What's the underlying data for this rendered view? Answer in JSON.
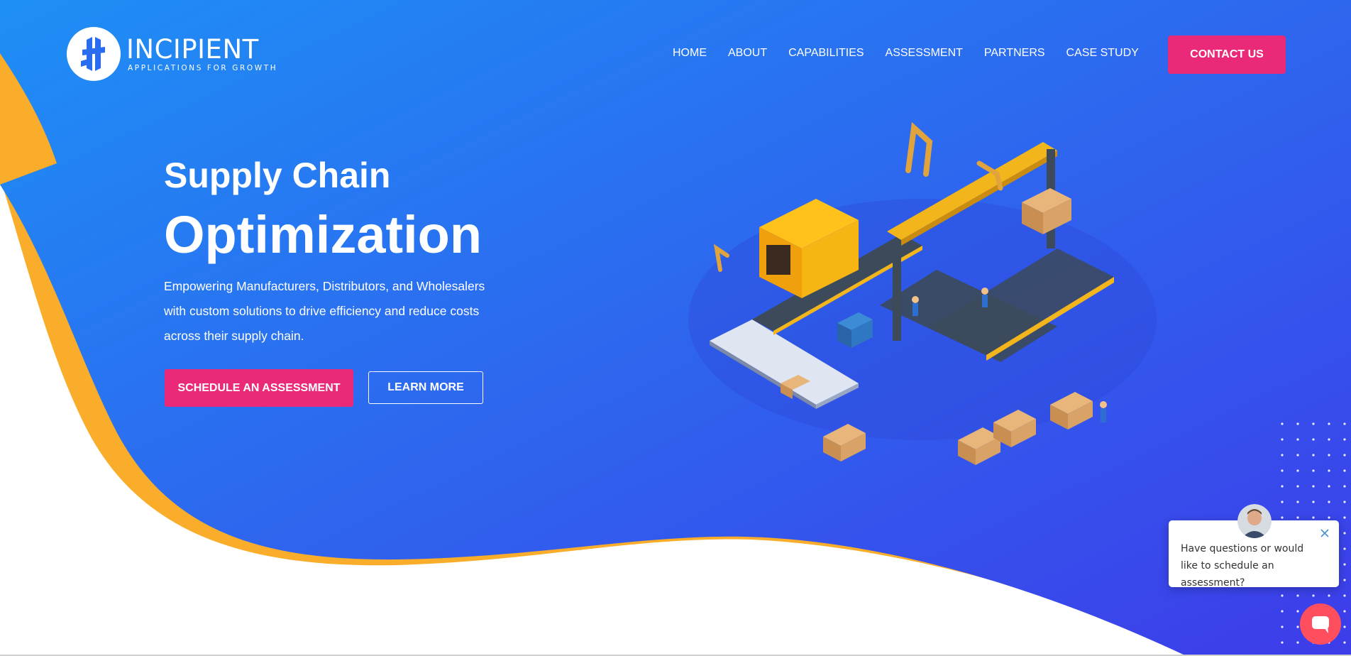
{
  "brand": {
    "name": "INCIPIENT",
    "tagline": "APPLICATIONS FOR GROWTH"
  },
  "nav": {
    "home": "HOME",
    "about": "ABOUT",
    "capabilities": "CAPABILITIES",
    "assessment": "ASSESSMENT",
    "partners": "PARTNERS",
    "case_study": "CASE STUDY"
  },
  "header": {
    "contact_label": "CONTACT US"
  },
  "hero": {
    "subtitle": "Supply Chain",
    "title": "Optimization",
    "description": "Empowering Manufacturers, Distributors, and Wholesalers with custom solutions to drive efficiency and reduce costs across their supply chain.",
    "primary_cta": "SCHEDULE AN ASSESSMENT",
    "secondary_cta": "LEARN MORE"
  },
  "chat": {
    "message": "Have questions or would like to schedule an assessment?"
  },
  "icons": [
    "logo-icon",
    "close-icon",
    "chat-icon",
    "avatar",
    "factory-illustration"
  ],
  "colors": {
    "gradient_start": "#1e8ff5",
    "gradient_end": "#3d3ce9",
    "accent_pink": "#ea2a78",
    "accent_orange": "#f9ad2a",
    "chat_bubble": "#ff4f5e"
  }
}
